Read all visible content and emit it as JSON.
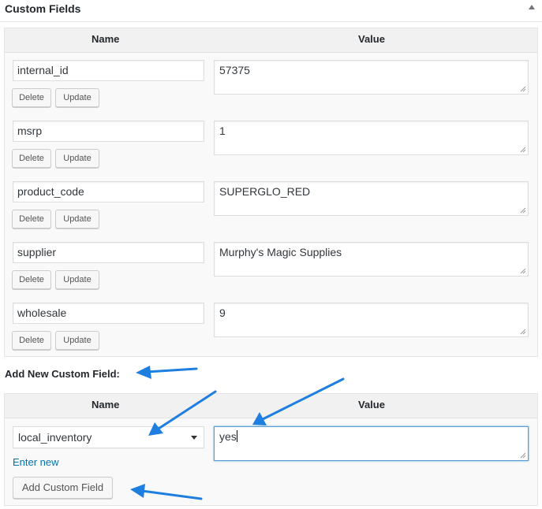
{
  "header": {
    "title": "Custom Fields"
  },
  "table": {
    "col_name": "Name",
    "col_value": "Value"
  },
  "fields": [
    {
      "key": "internal_id",
      "value": "57375"
    },
    {
      "key": "msrp",
      "value": "1"
    },
    {
      "key": "product_code",
      "value": "SUPERGLO_RED"
    },
    {
      "key": "supplier",
      "value": "Murphy's Magic Supplies"
    },
    {
      "key": "wholesale",
      "value": "9"
    }
  ],
  "buttons": {
    "delete": "Delete",
    "update": "Update"
  },
  "add_new": {
    "label": "Add New Custom Field:",
    "col_name": "Name",
    "col_value": "Value",
    "selected_key": "local_inventory",
    "value": "yes",
    "enter_new": "Enter new",
    "submit": "Add Custom Field"
  },
  "colors": {
    "arrow": "#1e7fe0",
    "link": "#0073aa",
    "focus": "#5b9dd9"
  }
}
